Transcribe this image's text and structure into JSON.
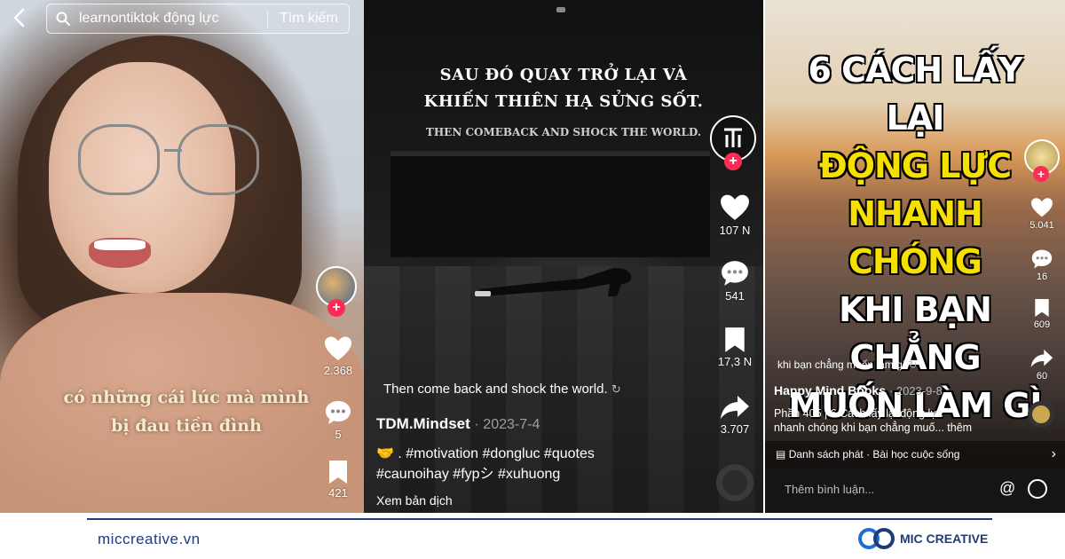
{
  "search": {
    "query": "learnontiktok động lực",
    "button_label": "Tìm kiếm"
  },
  "panel1": {
    "caption_line1": "có những cái lúc mà mình",
    "caption_line2": "bị đau tiền đình",
    "likes": "2.368",
    "comments": "5",
    "saves": "421"
  },
  "panel2": {
    "overlay_title_line1": "SAU ĐÓ QUAY TRỞ LẠI VÀ",
    "overlay_title_line2": "KHIẾN THIÊN HẠ SỬNG SỐT.",
    "overlay_subtitle": "THEN COMEBACK AND SHOCK THE WORLD.",
    "caption": "Then come back and shock the world.",
    "username": "TDM.Mindset",
    "date": "· 2023-7-4",
    "description_line1": "🤝 . #motivation #dongluc #quotes",
    "description_line2": "#caunoihay #fypシ #xuhuong",
    "translate_label": "Xem bản dịch",
    "likes": "107 N",
    "comments": "541",
    "saves": "17,3 N",
    "shares": "3.707"
  },
  "panel3": {
    "title_line1": "6 CÁCH LẤY LẠI",
    "title_line2": "ĐỘNG LỰC",
    "title_line3a": "NHANH ",
    "title_line3b": "CHÓNG",
    "title_line4": "KHI BẠN CHẲNG",
    "title_line5": "MUỐN LÀM GÌ",
    "tag_text": "khi bạn chẳng muốn làm gì",
    "username": "Happy Mind Books",
    "date": "· 2023-9-8",
    "description_line1": "Phần 405 | 6 Cách lấy lại động lực",
    "description_line2": "nhanh chóng khi bạn chẳng muố... thêm",
    "playlist": "Danh sách phát · Bài học cuộc sống",
    "comment_placeholder": "Thêm bình luận...",
    "likes": "5.041",
    "comments": "16",
    "saves": "609",
    "shares": "60"
  },
  "footer": {
    "website": "miccreative.vn",
    "brand": "MIC CREATIVE"
  },
  "colors": {
    "accent_red": "#fe2c55",
    "brand_blue": "#1f3b7a",
    "title_yellow": "#f5e000"
  },
  "icons": [
    "back-icon",
    "search-icon",
    "heart-icon",
    "comment-icon",
    "bookmark-icon",
    "share-icon",
    "plus-icon",
    "at-icon",
    "emoji-icon",
    "playlist-icon",
    "chevron-right-icon",
    "translate-icon"
  ]
}
